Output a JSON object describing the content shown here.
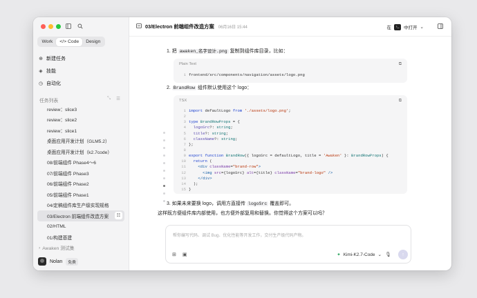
{
  "sidebar": {
    "tabs": [
      "Work",
      "</> Code",
      "Design"
    ],
    "nav": [
      {
        "icon": "⊕",
        "label": "新建任务"
      },
      {
        "icon": "◈",
        "label": "技能"
      },
      {
        "icon": "◷",
        "label": "自动化"
      }
    ],
    "section_label": "任务列表",
    "tasks": [
      "review：slice3",
      "review：slice2",
      "review：slice1",
      "桌面应用开发计划（GLM5.2）",
      "桌面应用开发计划（k2.7code）",
      "08/前端组件 Phase4～6",
      "07/前端组件 Phase3",
      "06/前端组件 Phase2",
      "05/前端组件 Phase1",
      "04/定稿组件库生产级实现规格",
      "03/Electron 前端组件改造方案",
      "02/HTML",
      "01/构建基建"
    ],
    "group_label": "Awaken 测试集",
    "user": {
      "name": "Nolan",
      "badge": "免费"
    }
  },
  "header": {
    "title": "03/Electron 前端组件改造方案",
    "date": "06月16日 15:44",
    "open_in_prefix": "在",
    "open_in_label": "中打开"
  },
  "content": {
    "step1": {
      "num": "1. 把",
      "code": "awaken_名字设计.png",
      "rest": "复制到组件库目录，比如："
    },
    "block1": {
      "lang": "Plain Text",
      "line_num": "1",
      "code": "frontend/src/components/navigation/assets/logo.png"
    },
    "step2": {
      "num": "2.",
      "code": "BrandRow",
      "rest": "组件默认使用这个 logo："
    },
    "block2": {
      "lang": "TSX"
    },
    "step3": {
      "text1": "3. 如果未来要换 logo，调用方直接传",
      "code": "logoSrc",
      "text2": "覆盖即可。"
    },
    "summary": "这样既方便组件库内部使用，也方便外部复用和替换。你觉得这个方案可以吗？"
  },
  "composer": {
    "placeholder": "帮你编写代码、调试 Bug、优化性能等开发工作，交付生产级代码产物。",
    "model": "Kimi-K2.7-Code"
  }
}
